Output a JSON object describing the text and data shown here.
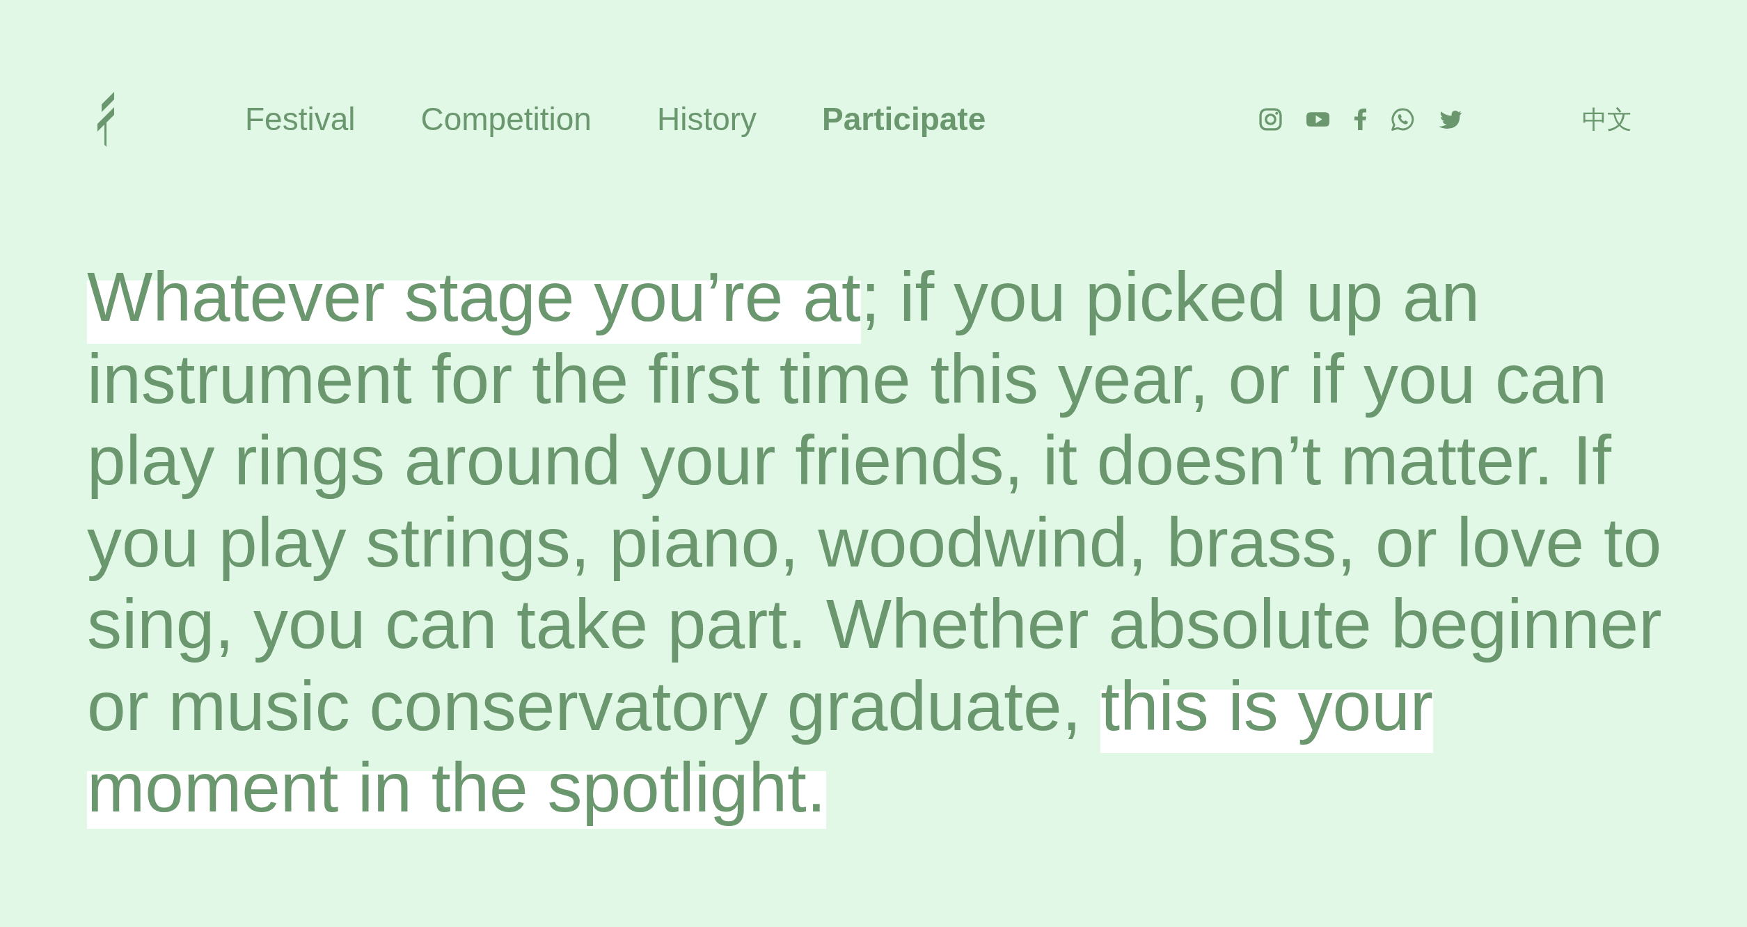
{
  "header": {
    "nav": [
      {
        "label": "Festival",
        "selected": false
      },
      {
        "label": "Competition",
        "selected": false
      },
      {
        "label": "History",
        "selected": false
      },
      {
        "label": "Participate",
        "selected": true
      }
    ],
    "language": "中文"
  },
  "intro": {
    "segments": [
      {
        "text": "Whatever stage you’re at",
        "highlighted": true
      },
      {
        "text": "; if you picked up an instrument for the first time this year, or if you can play rings around your friends, it doesn’t matter. If you play strings, piano, woodwind, brass, or love to sing, you can take part. Whether absolute beginner or music conservatory graduate, ",
        "highlighted": false
      },
      {
        "text": "this is your moment in the spotlight.",
        "highlighted": true
      }
    ]
  }
}
